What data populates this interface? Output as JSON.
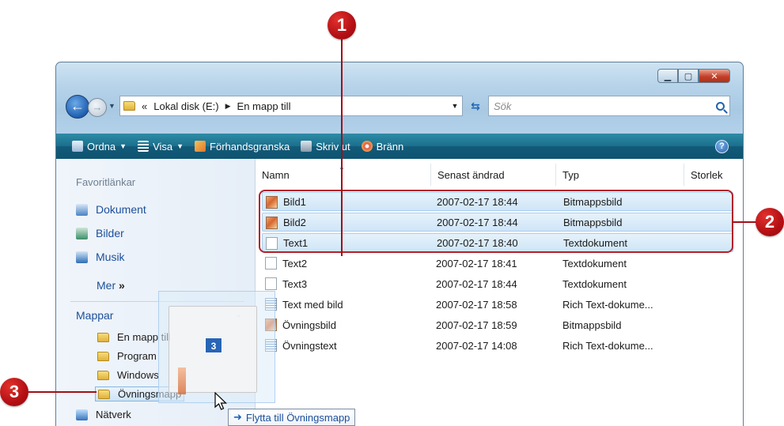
{
  "callouts": [
    "1",
    "2",
    "3"
  ],
  "address": {
    "breadcrumbs": [
      "Lokal disk (E:)",
      "En mapp till"
    ],
    "prefix": "«",
    "search_placeholder": "Sök"
  },
  "toolbar": {
    "items": [
      {
        "label": "Ordna",
        "icon": "organize-icon",
        "has_dropdown": true
      },
      {
        "label": "Visa",
        "icon": "views-icon",
        "has_dropdown": true
      },
      {
        "label": "Förhandsgranska",
        "icon": "preview-icon",
        "has_dropdown": false
      },
      {
        "label": "Skriv ut",
        "icon": "printer-icon",
        "has_dropdown": false
      },
      {
        "label": "Bränn",
        "icon": "burn-icon",
        "has_dropdown": false
      }
    ],
    "help": "?"
  },
  "navpane": {
    "favorites_heading": "Favoritlänkar",
    "links": [
      "Dokument",
      "Bilder",
      "Musik"
    ],
    "more": "Mer",
    "folders_heading": "Mappar",
    "tree": [
      "En mapp till",
      "Program",
      "Windows",
      "Övningsmapp"
    ],
    "network": "Nätverk"
  },
  "columns": [
    "Namn",
    "Senast ändrad",
    "Typ",
    "Storlek"
  ],
  "files": [
    {
      "name": "Bild1",
      "modified": "2007-02-17 18:44",
      "type": "Bitmappsbild",
      "kind": "img",
      "selected": true
    },
    {
      "name": "Bild2",
      "modified": "2007-02-17 18:44",
      "type": "Bitmappsbild",
      "kind": "img",
      "selected": true
    },
    {
      "name": "Text1",
      "modified": "2007-02-17 18:40",
      "type": "Textdokument",
      "kind": "txt",
      "selected": true
    },
    {
      "name": "Text2",
      "modified": "2007-02-17 18:41",
      "type": "Textdokument",
      "kind": "txt",
      "selected": false
    },
    {
      "name": "Text3",
      "modified": "2007-02-17 18:44",
      "type": "Textdokument",
      "kind": "txt",
      "selected": false
    },
    {
      "name": "Text med bild",
      "modified": "2007-02-17 18:58",
      "type": "Rich Text-dokume...",
      "kind": "rtf",
      "selected": false
    },
    {
      "name": "Övningsbild",
      "modified": "2007-02-17 18:59",
      "type": "Bitmappsbild",
      "kind": "img",
      "selected": false
    },
    {
      "name": "Övningstext",
      "modified": "2007-02-17 14:08",
      "type": "Rich Text-dokume...",
      "kind": "rtf",
      "selected": false
    }
  ],
  "drag": {
    "count": "3",
    "tooltip": "Flytta till Övningsmapp"
  },
  "colors": {
    "callout": "#b30f14",
    "toolbar": "#1a6f8d",
    "selection": "#cfe5f7",
    "link": "#1c4f9a"
  }
}
